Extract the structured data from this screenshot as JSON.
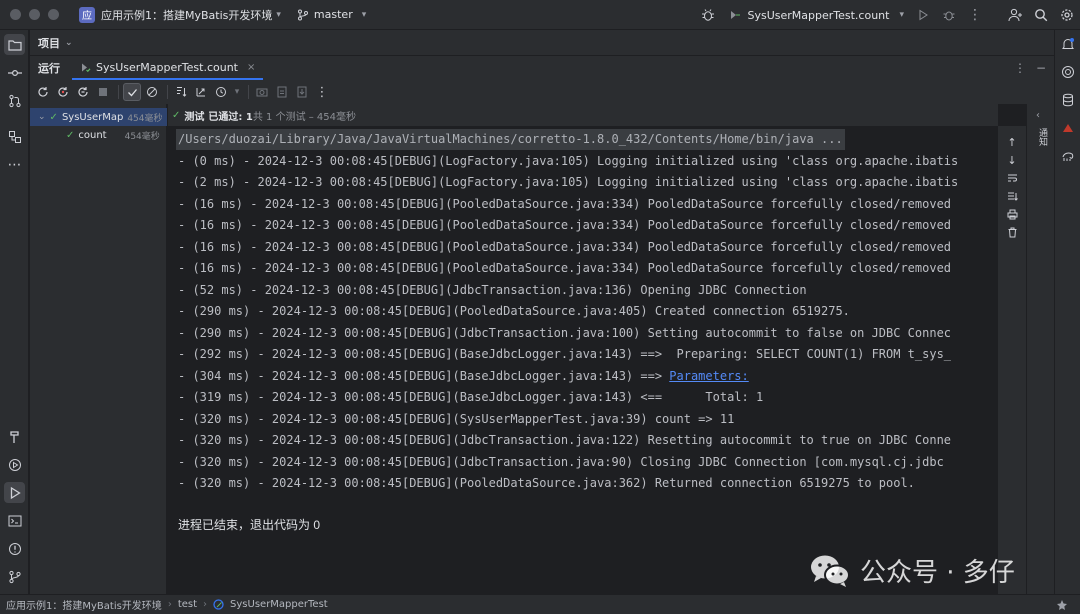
{
  "window": {
    "project_badge": "应",
    "project_name": "应用示例1：搭建MyBatis开发环境",
    "branch": "master",
    "run_config": "SysUserMapperTest.count"
  },
  "panels": {
    "project_label": "项目",
    "run_label": "运行",
    "run_tab_label": "SysUserMapperTest.count",
    "right_panel_label": "通知"
  },
  "test_tree": {
    "root": {
      "label": "SysUserMap",
      "duration": "454毫秒"
    },
    "child": {
      "label": "count",
      "duration": "454毫秒"
    }
  },
  "test_status": {
    "prefix": "测试",
    "passed": "已通过: 1",
    "summary": "共 1 个测试 – 454毫秒"
  },
  "console": {
    "lines": [
      "/Users/duozai/Library/Java/JavaVirtualMachines/corretto-1.8.0_432/Contents/Home/bin/java ...",
      "- (0 ms) - 2024-12-3 00:08:45[DEBUG](LogFactory.java:105) Logging initialized using 'class org.apache.ibatis",
      "- (2 ms) - 2024-12-3 00:08:45[DEBUG](LogFactory.java:105) Logging initialized using 'class org.apache.ibatis",
      "- (16 ms) - 2024-12-3 00:08:45[DEBUG](PooledDataSource.java:334) PooledDataSource forcefully closed/removed",
      "- (16 ms) - 2024-12-3 00:08:45[DEBUG](PooledDataSource.java:334) PooledDataSource forcefully closed/removed",
      "- (16 ms) - 2024-12-3 00:08:45[DEBUG](PooledDataSource.java:334) PooledDataSource forcefully closed/removed",
      "- (16 ms) - 2024-12-3 00:08:45[DEBUG](PooledDataSource.java:334) PooledDataSource forcefully closed/removed",
      "- (52 ms) - 2024-12-3 00:08:45[DEBUG](JdbcTransaction.java:136) Opening JDBC Connection",
      "- (290 ms) - 2024-12-3 00:08:45[DEBUG](PooledDataSource.java:405) Created connection 6519275.",
      "- (290 ms) - 2024-12-3 00:08:45[DEBUG](JdbcTransaction.java:100) Setting autocommit to false on JDBC Connec",
      "- (292 ms) - 2024-12-3 00:08:45[DEBUG](BaseJdbcLogger.java:143) ==>  Preparing: SELECT COUNT(1) FROM t_sys_",
      "- (304 ms) - 2024-12-3 00:08:45[DEBUG](BaseJdbcLogger.java:143) ==> ",
      "- (319 ms) - 2024-12-3 00:08:45[DEBUG](BaseJdbcLogger.java:143) <==      Total: 1",
      "- (320 ms) - 2024-12-3 00:08:45[DEBUG](SysUserMapperTest.java:39) count => 11",
      "- (320 ms) - 2024-12-3 00:08:45[DEBUG](JdbcTransaction.java:122) Resetting autocommit to true on JDBC Conne",
      "- (320 ms) - 2024-12-3 00:08:45[DEBUG](JdbcTransaction.java:90) Closing JDBC Connection [com.mysql.cj.jdbc",
      "- (320 ms) - 2024-12-3 00:08:45[DEBUG](PooledDataSource.java:362) Returned connection 6519275 to pool."
    ],
    "params_link": "Parameters:",
    "exit_text": "进程已结束，退出代码为 0"
  },
  "statusbar": {
    "crumbs": [
      "应用示例1：搭建MyBatis开发环境",
      "test",
      "SysUserMapperTest"
    ]
  },
  "watermark": {
    "text": "公众号 · 多仔"
  },
  "colors": {
    "accent": "#3574f0",
    "pass": "#5fb865",
    "link": "#548af7"
  }
}
